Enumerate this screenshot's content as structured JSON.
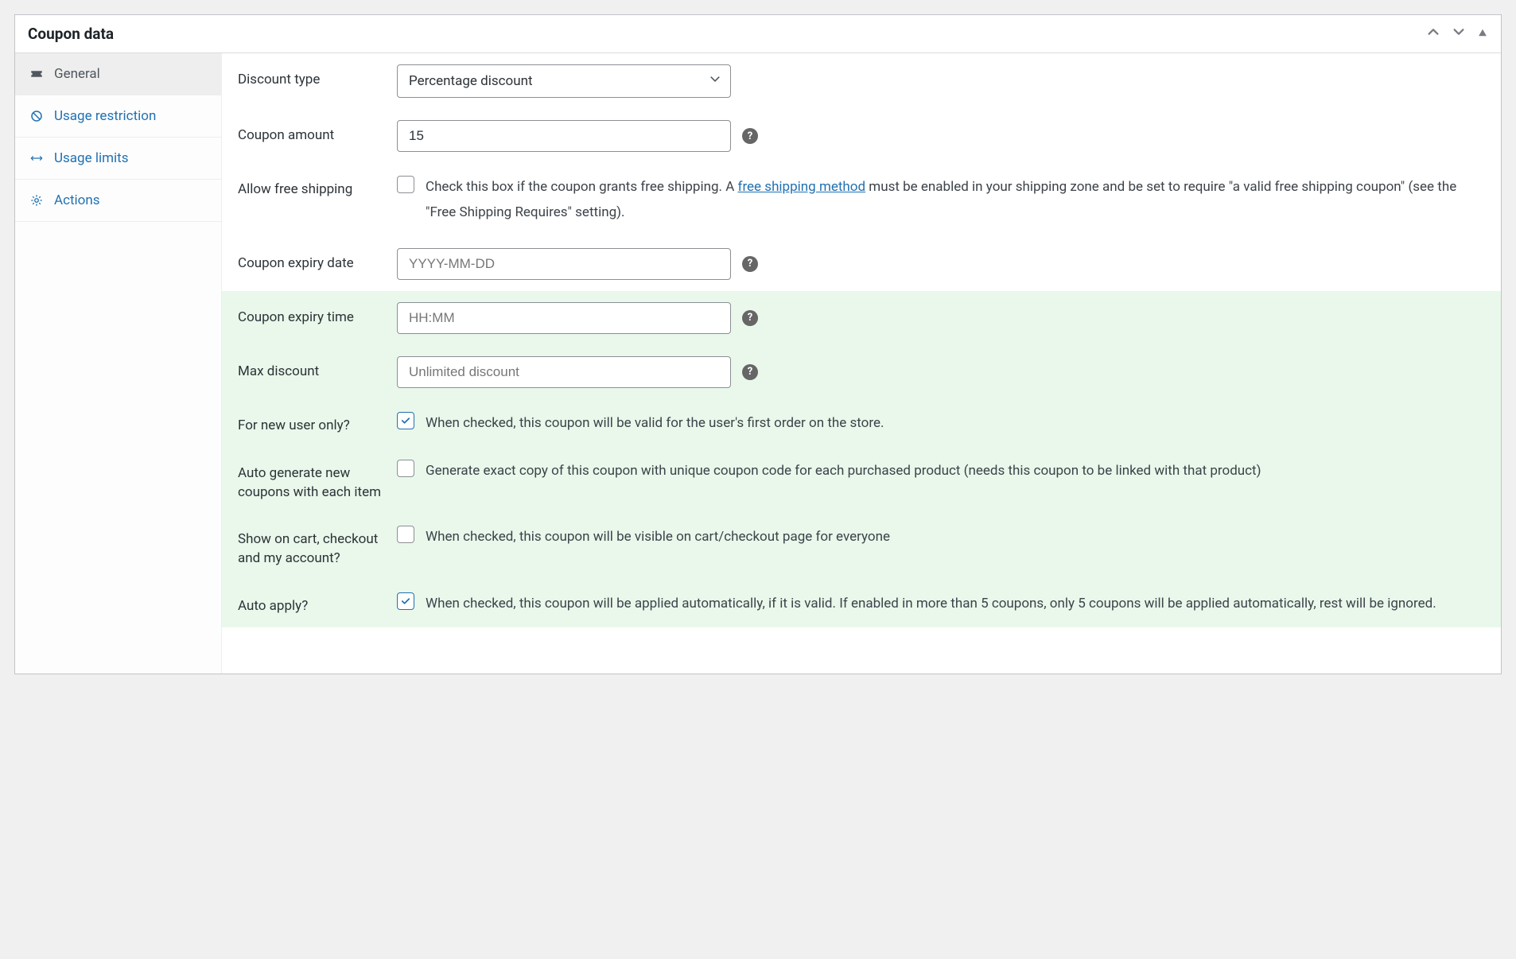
{
  "panel": {
    "title": "Coupon data"
  },
  "sidebar": {
    "tabs": [
      {
        "label": "General"
      },
      {
        "label": "Usage restriction"
      },
      {
        "label": "Usage limits"
      },
      {
        "label": "Actions"
      }
    ]
  },
  "form": {
    "discount_type": {
      "label": "Discount type",
      "selected": "Percentage discount"
    },
    "coupon_amount": {
      "label": "Coupon amount",
      "value": "15"
    },
    "free_shipping": {
      "label": "Allow free shipping",
      "desc_pre": "Check this box if the coupon grants free shipping. A ",
      "link_text": "free shipping method",
      "desc_post": " must be enabled in your shipping zone and be set to require \"a valid free shipping coupon\" (see the \"Free Shipping Requires\" setting)."
    },
    "expiry_date": {
      "label": "Coupon expiry date",
      "placeholder": "YYYY-MM-DD"
    },
    "expiry_time": {
      "label": "Coupon expiry time",
      "placeholder": "HH:MM"
    },
    "max_discount": {
      "label": "Max discount",
      "placeholder": "Unlimited discount"
    },
    "new_user_only": {
      "label": "For new user only?",
      "desc": "When checked, this coupon will be valid for the user's first order on the store."
    },
    "auto_generate": {
      "label": "Auto generate new coupons with each item",
      "desc": "Generate exact copy of this coupon with unique coupon code for each purchased product (needs this coupon to be linked with that product)"
    },
    "show_on_cart": {
      "label": "Show on cart, checkout and my account?",
      "desc": "When checked, this coupon will be visible on cart/checkout page for everyone"
    },
    "auto_apply": {
      "label": "Auto apply?",
      "desc": "When checked, this coupon will be applied automatically, if it is valid. If enabled in more than 5 coupons, only 5 coupons will be applied automatically, rest will be ignored."
    }
  },
  "help": "?"
}
